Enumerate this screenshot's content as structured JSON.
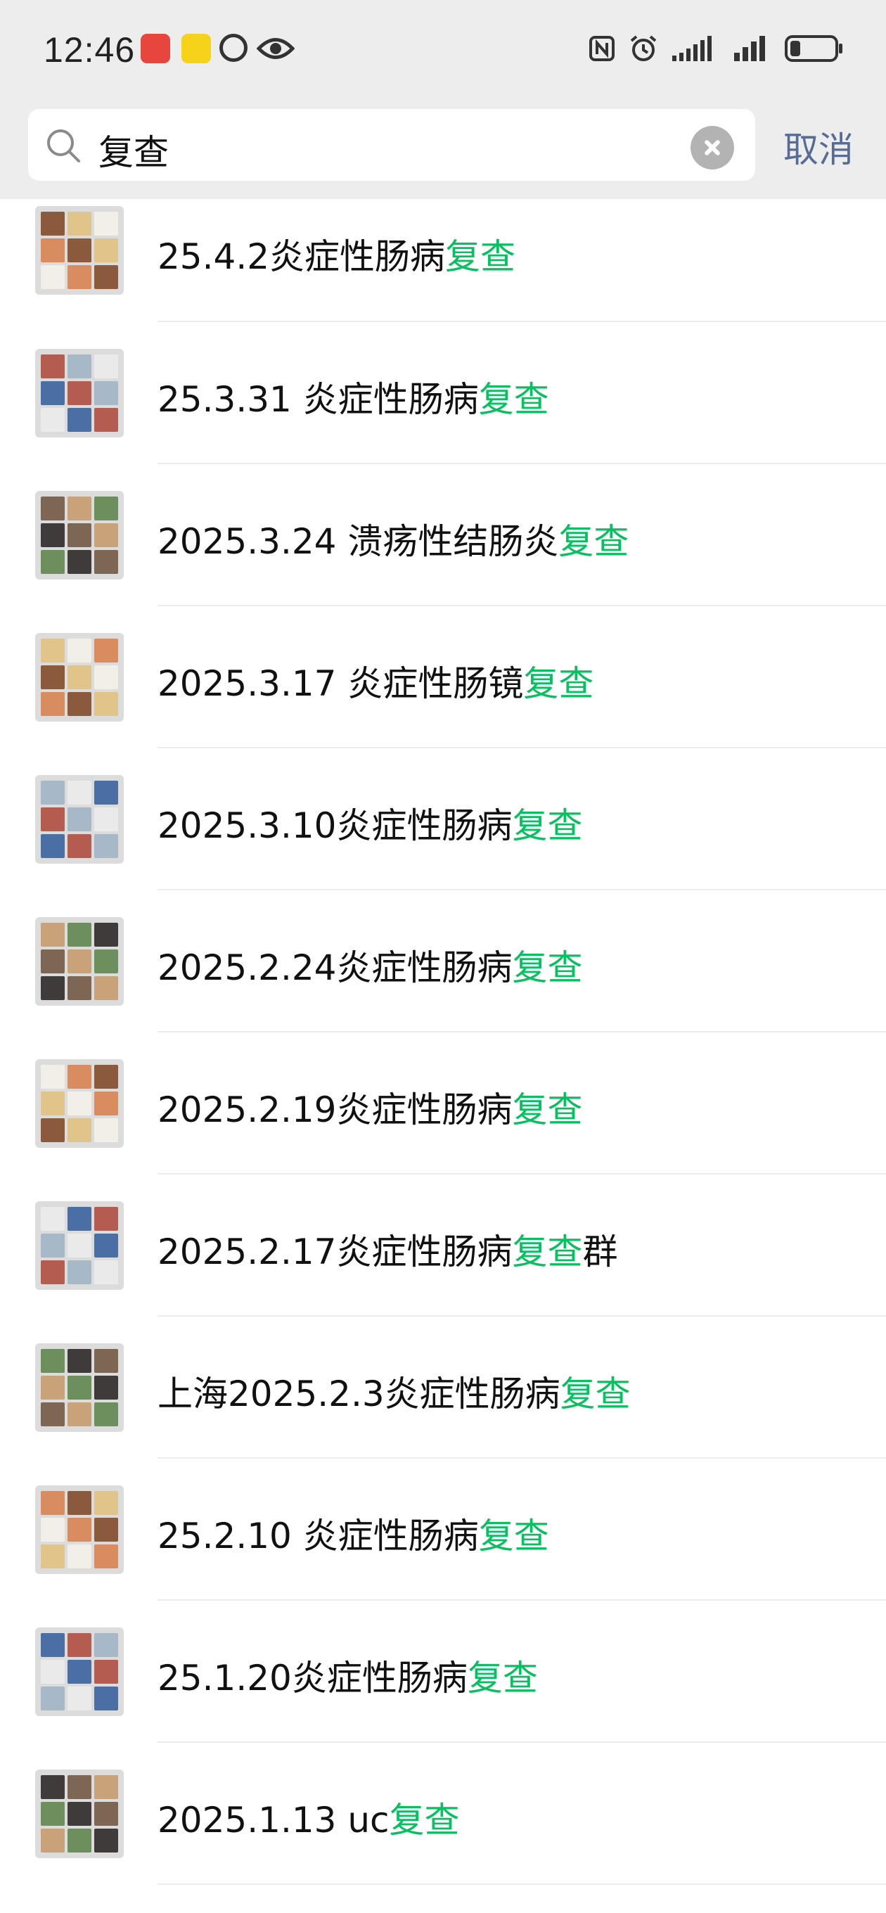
{
  "status_bar": {
    "time": "12:46"
  },
  "search": {
    "query": "复查",
    "cancel_label": "取消"
  },
  "colors": {
    "highlight": "#07c160",
    "cancel": "#576b95"
  },
  "results": [
    {
      "prefix": "25.4.2炎症性肠病",
      "match": "复查",
      "suffix": ""
    },
    {
      "prefix": "25.3.31 炎症性肠病",
      "match": "复查",
      "suffix": ""
    },
    {
      "prefix": "2025.3.24 溃疡性结肠炎",
      "match": "复查",
      "suffix": ""
    },
    {
      "prefix": "2025.3.17 炎症性肠镜",
      "match": "复查",
      "suffix": ""
    },
    {
      "prefix": "2025.3.10炎症性肠病",
      "match": "复查",
      "suffix": ""
    },
    {
      "prefix": "2025.2.24炎症性肠病",
      "match": "复查",
      "suffix": ""
    },
    {
      "prefix": "2025.2.19炎症性肠病",
      "match": "复查",
      "suffix": ""
    },
    {
      "prefix": "2025.2.17炎症性肠病",
      "match": "复查",
      "suffix": "群"
    },
    {
      "prefix": "上海2025.2.3炎症性肠病",
      "match": "复查",
      "suffix": ""
    },
    {
      "prefix": "25.2.10 炎症性肠病",
      "match": "复查",
      "suffix": ""
    },
    {
      "prefix": "25.1.20炎症性肠病",
      "match": "复查",
      "suffix": ""
    },
    {
      "prefix": "2025.1.13 uc",
      "match": "复查",
      "suffix": ""
    }
  ]
}
